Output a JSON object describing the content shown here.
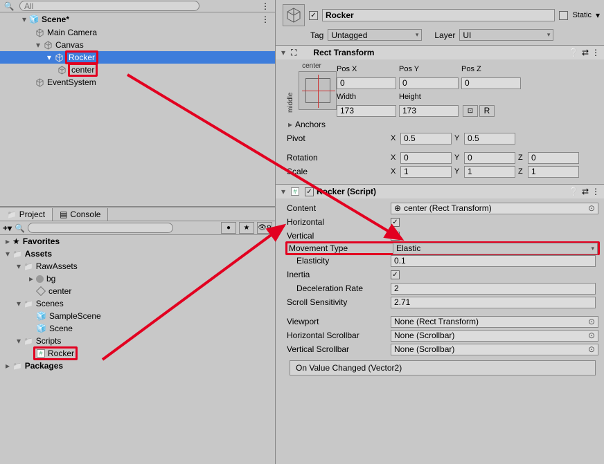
{
  "hierarchy": {
    "search_placeholder": "All",
    "scene": "Scene*",
    "main_camera": "Main Camera",
    "canvas": "Canvas",
    "rocker": "Rocker",
    "center": "center",
    "event_system": "EventSystem"
  },
  "project": {
    "tabs": {
      "project": "Project",
      "console": "Console"
    },
    "search_placeholder": "",
    "eye_count": "8",
    "favorites": "Favorites",
    "assets": "Assets",
    "raw_assets": "RawAssets",
    "bg": "bg",
    "center_asset": "center",
    "scenes": "Scenes",
    "sample_scene": "SampleScene",
    "scene_file": "Scene",
    "scripts": "Scripts",
    "rocker_script": "Rocker",
    "packages": "Packages"
  },
  "inspector": {
    "name": "Rocker",
    "static": "Static",
    "tag_label": "Tag",
    "tag_value": "Untagged",
    "layer_label": "Layer",
    "layer_value": "UI",
    "rect_transform": {
      "title": "Rect Transform",
      "anchor_h": "center",
      "anchor_v": "middle",
      "posx_label": "Pos X",
      "posx": "0",
      "posy_label": "Pos Y",
      "posy": "0",
      "posz_label": "Pos Z",
      "posz": "0",
      "width_label": "Width",
      "width": "173",
      "height_label": "Height",
      "height": "173",
      "r_btn": "R",
      "anchors": "Anchors",
      "pivot": "Pivot",
      "pivot_x": "0.5",
      "pivot_y": "0.5",
      "rotation": "Rotation",
      "rot_x": "0",
      "rot_y": "0",
      "rot_z": "0",
      "scale": "Scale",
      "scale_x": "1",
      "scale_y": "1",
      "scale_z": "1"
    },
    "script": {
      "title": "Rocker (Script)",
      "content_label": "Content",
      "content_value": "center (Rect Transform)",
      "horizontal": "Horizontal",
      "vertical": "Vertical",
      "movement_type": "Movement Type",
      "movement_value": "Elastic",
      "elasticity": "Elasticity",
      "elasticity_val": "0.1",
      "inertia": "Inertia",
      "decel": "Deceleration Rate",
      "decel_val": "2",
      "scroll_sens": "Scroll Sensitivity",
      "scroll_sens_val": "2.71",
      "viewport": "Viewport",
      "viewport_val": "None (Rect Transform)",
      "h_scrollbar": "Horizontal Scrollbar",
      "h_scrollbar_val": "None (Scrollbar)",
      "v_scrollbar": "Vertical Scrollbar",
      "v_scrollbar_val": "None (Scrollbar)",
      "on_value_changed": "On Value Changed (Vector2)"
    }
  },
  "axis": {
    "X": "X",
    "Y": "Y",
    "Z": "Z"
  }
}
